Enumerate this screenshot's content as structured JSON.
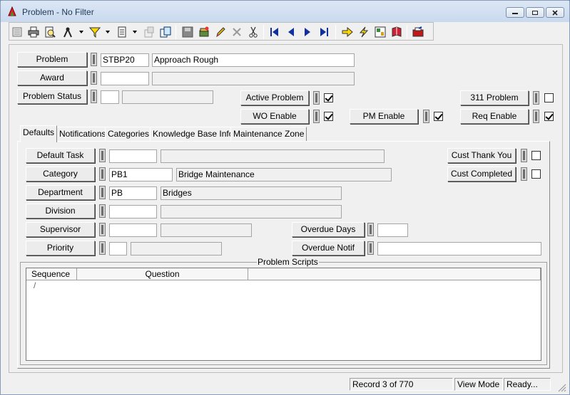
{
  "window": {
    "title": "Problem - No Filter"
  },
  "header": {
    "problem_label": "Problem",
    "problem_code": "STBP20",
    "problem_desc": "Approach Rough",
    "award_label": "Award",
    "award_code": "",
    "award_desc": "",
    "status_label": "Problem Status",
    "status_code": "",
    "status_desc": "",
    "active_label": "Active Problem",
    "active_checked": true,
    "wo_label": "WO Enable",
    "wo_checked": true,
    "pm_label": "PM Enable",
    "pm_checked": true,
    "p311_label": "311 Problem",
    "p311_checked": false,
    "req_label": "Req Enable",
    "req_checked": true
  },
  "tabs": [
    "Defaults",
    "Notifications",
    "Categories",
    "Knowledge Base Info",
    "Maintenance Zone"
  ],
  "defaults": {
    "default_task_label": "Default Task",
    "default_task_code": "",
    "default_task_desc": "",
    "category_label": "Category",
    "category_code": "PB1",
    "category_desc": "Bridge Maintenance",
    "department_label": "Department",
    "department_code": "PB",
    "department_desc": "Bridges",
    "division_label": "Division",
    "division_code": "",
    "division_desc": "",
    "supervisor_label": "Supervisor",
    "supervisor_code": "",
    "supervisor_desc": "",
    "priority_label": "Priority",
    "priority_code": "",
    "priority_desc": "",
    "cust_thank_label": "Cust Thank You",
    "cust_thank_checked": false,
    "cust_completed_label": "Cust Completed",
    "cust_completed_checked": false,
    "overdue_days_label": "Overdue Days",
    "overdue_days_value": "",
    "overdue_notif_label": "Overdue Notif",
    "overdue_notif_value": ""
  },
  "scripts": {
    "group_label": "Problem Scripts",
    "columns": [
      "Sequence",
      "Question"
    ],
    "sort_indicator": "/"
  },
  "status": {
    "record": "Record 3 of 770",
    "mode": "View Mode",
    "state": "Ready..."
  },
  "colors": {
    "title_text": "#1e3957",
    "nav_blue": "#1030a0",
    "accent_red": "#c01818"
  }
}
